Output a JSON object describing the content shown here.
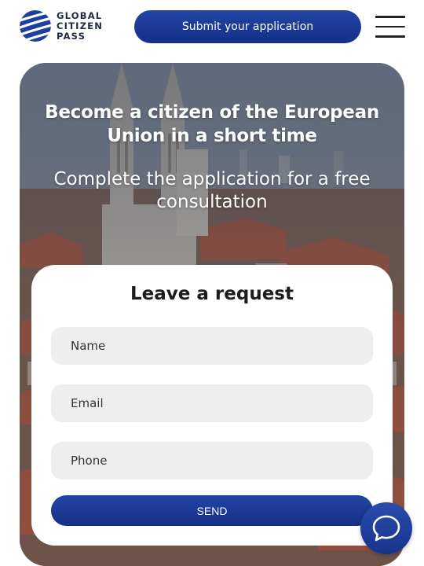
{
  "header": {
    "logo_lines": [
      "GLOBAL",
      "CITIZEN",
      "PASS"
    ],
    "cta_label": "Submit your application",
    "menu_icon": "hamburger-icon"
  },
  "hero": {
    "title": "Become a citizen of the European Union in a short time",
    "subtitle": "Complete the application for a free consultation"
  },
  "form": {
    "title": "Leave a request",
    "name_placeholder": "Name",
    "email_placeholder": "Email",
    "phone_placeholder": "Phone",
    "send_label": "SEND"
  },
  "chat": {
    "icon": "chat-bubble-icon"
  },
  "colors": {
    "brand_blue": "#1b3a95",
    "field_bg": "#eeeeee"
  }
}
